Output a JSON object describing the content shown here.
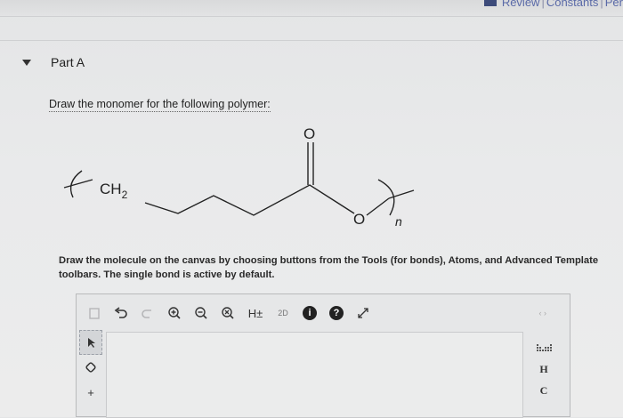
{
  "header": {
    "review_link": "Review",
    "constants_link": "Constants",
    "periodic_link": "Per"
  },
  "part": {
    "title": "Part A",
    "instruction": "Draw the monomer for the following polymer:"
  },
  "structure": {
    "carbonyl_oxygen": "O",
    "ch2_label": "CH",
    "ch2_subscript": "2",
    "ester_oxygen": "O",
    "repeat_n": "n"
  },
  "description": "Draw the molecule on the canvas by choosing buttons from the Tools (for bonds), Atoms, and Advanced Template toolbars. The single bond is active by default.",
  "editor": {
    "toolbar": {
      "h_toggle": "H±",
      "view_2d": "2D",
      "info": "i",
      "help": "?"
    },
    "atoms": [
      "H",
      "C"
    ]
  }
}
